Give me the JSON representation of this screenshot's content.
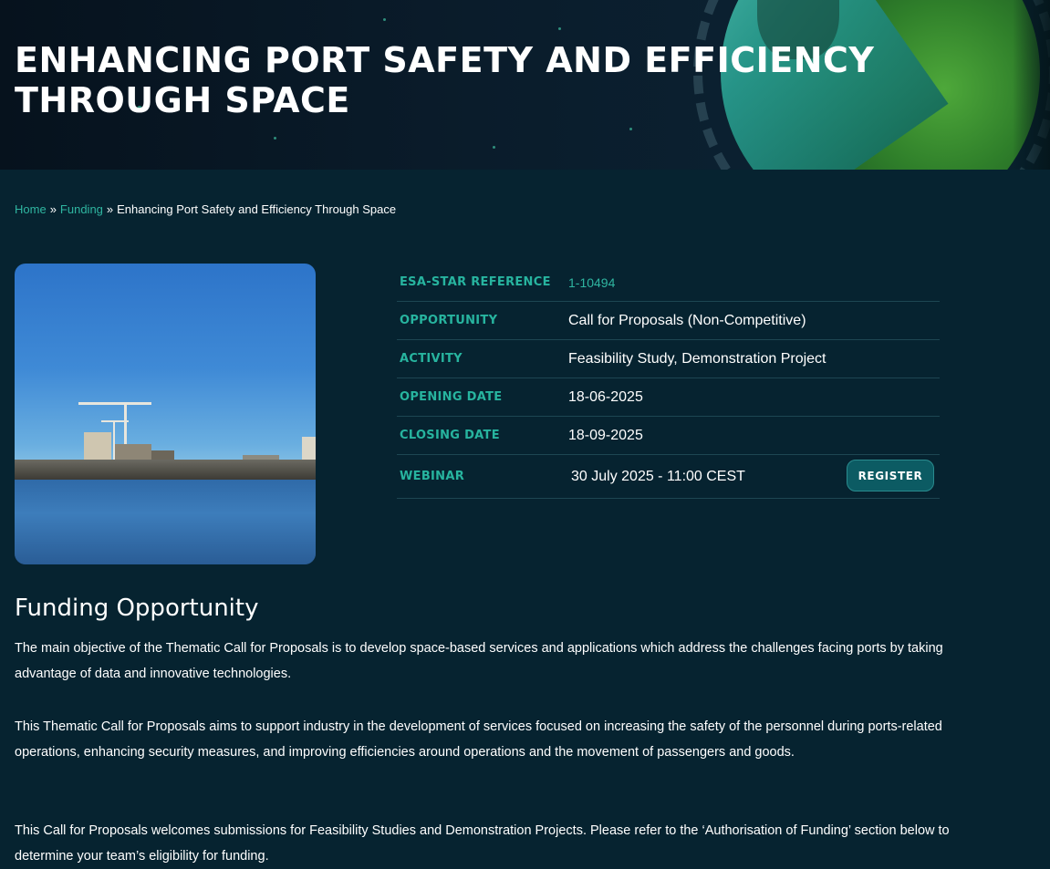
{
  "banner": {
    "title": "ENHANCING PORT SAFETY AND EFFICIENCY THROUGH SPACE"
  },
  "breadcrumb": {
    "home": "Home",
    "funding": "Funding",
    "separator": "»",
    "current": "Enhancing Port Safety and Efficiency Through Space"
  },
  "info": {
    "rows": [
      {
        "label": "ESA-STAR REFERENCE",
        "value": "1-10494"
      },
      {
        "label": "OPPORTUNITY",
        "value": "Call for Proposals (Non-Competitive)"
      },
      {
        "label": "ACTIVITY",
        "value": "Feasibility Study, Demonstration Project"
      },
      {
        "label": "OPENING DATE",
        "value": "18-06-2025"
      },
      {
        "label": "CLOSING DATE",
        "value": "18-09-2025"
      },
      {
        "label": "WEBINAR",
        "value": "30 July 2025 - 11:00 CEST"
      }
    ],
    "register_label": "REGISTER"
  },
  "funding": {
    "title": "Funding Opportunity",
    "paragraphs": [
      "The main objective of the Thematic Call for Proposals is to develop space-based services and applications which address the challenges facing ports by taking advantage of data and innovative technologies.",
      "This Thematic Call for Proposals aims to support industry in the development of services focused on increasing the safety of the personnel during ports-related operations, enhancing security measures, and improving efficiencies around operations and the movement of passengers and goods.",
      "This Call for Proposals welcomes submissions for Feasibility Studies and Demonstration Projects. Please refer to the ‘Authorisation of Funding’ section below to determine your team’s eligibility for funding."
    ]
  },
  "colors": {
    "background": "#062330",
    "accent": "#27b49f",
    "button": "#0c5b63"
  },
  "icons": {
    "banner_graphic": "globe-graphic"
  }
}
